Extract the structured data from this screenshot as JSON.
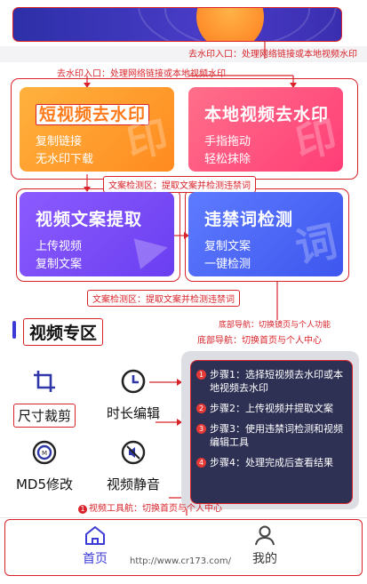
{
  "annotations": {
    "watermark_entry_right": "去水印入口：处理网络链接或本地视频水印",
    "watermark_entry_left": "去水印入口：处理网络链接或本地视频水印",
    "copy_detect_top": "文案检测区：提取文案并检测违禁词",
    "copy_detect_bottom": "文案检测区：提取文案并检测违禁词",
    "bottom_nav_1": "底部导航：切换镜页与个人功能",
    "bottom_nav_2": "底部导航：切换首页与个人中心",
    "tool_nav": "视频工具航：切换首页与个人中心",
    "tool_nav_num": "1"
  },
  "cards": [
    {
      "title": "短视频去水印",
      "line1": "复制链接",
      "line2": "无水印下载",
      "deco": "印"
    },
    {
      "title": "本地视频去水印",
      "line1": "手指拖动",
      "line2": "轻松抹除",
      "deco": "印"
    },
    {
      "title": "视频文案提取",
      "line1": "上传视频",
      "line2": "复制文案",
      "deco": "▶"
    },
    {
      "title": "违禁词检测",
      "line1": "复制文案",
      "line2": "一键检测",
      "deco": "词"
    }
  ],
  "section": {
    "title": "视频专区"
  },
  "tools": [
    {
      "label": "尺寸裁剪"
    },
    {
      "label": "时长编辑"
    },
    {
      "label": "MD5修改"
    },
    {
      "label": "视频静音"
    }
  ],
  "steps": [
    {
      "num": "1",
      "text": "步骤1：选择短视频去水印或本地视频去水印"
    },
    {
      "num": "2",
      "text": "步骤2：上传视频并提取文案"
    },
    {
      "num": "3",
      "text": "步骤3：使用违禁词检测和视频编辑工具"
    },
    {
      "num": "4",
      "text": "步骤4：处理完成后查看结果"
    }
  ],
  "nav": {
    "home": "首页",
    "mine": "我的"
  },
  "watermark_url": "http://www.cr173.com/",
  "colors": {
    "accent_red": "#d8232a",
    "brand_blue": "#3c3ad6"
  }
}
